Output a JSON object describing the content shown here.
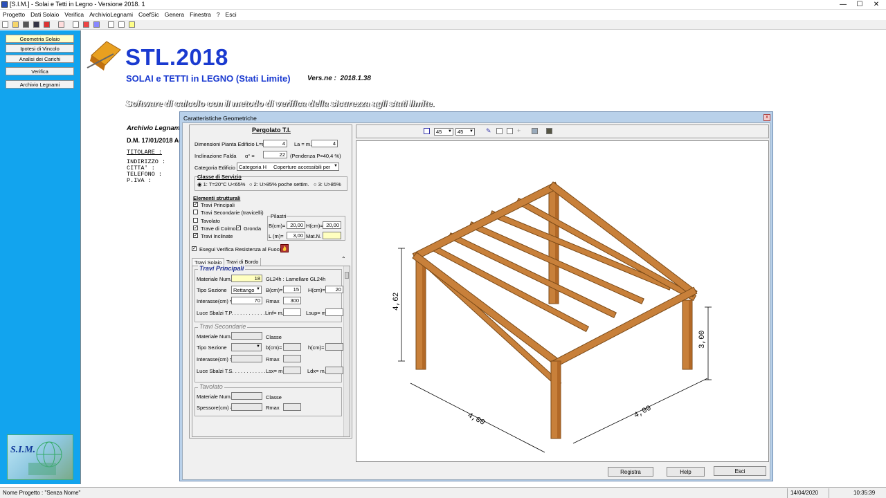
{
  "window": {
    "title": "[S.I.M.] - Solai e Tetti in Legno - Versione  2018. 1",
    "minimize": "—",
    "maximize": "☐",
    "close": "✕"
  },
  "menu": [
    "Progetto",
    "Dati Solaio",
    "Verifica",
    "ArchivioLegnami",
    "CoefSic",
    "Genera",
    "Finestra",
    "?",
    "Esci"
  ],
  "sidebar": {
    "items": [
      {
        "label": "Geometria Solaio"
      },
      {
        "label": "Ipotesi di Vincolo"
      },
      {
        "label": "Analisi dei Carichi"
      },
      {
        "label": "Verifica"
      },
      {
        "label": "Archivio Legnami"
      }
    ],
    "logo_text": "S.I.M."
  },
  "splash": {
    "title": "STL.2018",
    "subtitle": "SOLAI e TETTI in LEGNO (Stati Limite)",
    "version_label": "Vers.ne :",
    "version": "2018.1.38",
    "tagline": "Software di calcolo con il metodo di verifica della sicurezza agli stati limite.",
    "archivio": "Archivio Legnami,",
    "dm": "D.M. 17/01/2018  Ac",
    "titolare": "TITOLARE  :",
    "indirizzo": "INDIRIZZO :",
    "citta": "CITTA'    :",
    "telefono": "TELEFONO  :",
    "piva": "P.IVA     :"
  },
  "dialog": {
    "title": "Caratteristiche Geometriche",
    "close": "x",
    "panel_title": "Pergolato T.I.",
    "dim_label": "Dimensioni Pianta Edificio L=m.",
    "L": "4",
    "La_label": "La = m.",
    "La": "4",
    "incl_label": "Inclinazione Falda",
    "alpha_label": "α°  =",
    "alpha": "22",
    "pendenza": "(Pendenza P=40,4 %)",
    "cat_label": "Categoria Edificio",
    "cat_value": "Categoria H",
    "cat_desc": "Coperture accessibili per s",
    "classe_title": "Classe di Servizio",
    "classe": [
      "1: T=20°C  U<65%",
      "2: U>85% poche settim.",
      "3: U>85%"
    ],
    "elementi_title": "Elementi strutturali",
    "elementi": [
      {
        "label": "Travi Principali",
        "checked": true
      },
      {
        "label": "Travi Secondarie (travicelli)",
        "checked": false
      },
      {
        "label": "Tavolato",
        "checked": false
      },
      {
        "label": "Trave di Colmo",
        "checked": true
      },
      {
        "label": "Travi Inclinate",
        "checked": true
      }
    ],
    "gronda_label": "Gronda",
    "pilastri_title": "Pilastri",
    "B_label": "B(cm)=",
    "B": "20,00",
    "H_label": "H(cm)=",
    "H": "20,00",
    "Lp_label": "L (m)=",
    "Lp": "3,00",
    "mat_label": "Mat.N.",
    "fuoco_label": "Esegui Verifica Resistenza al Fuoco",
    "tabs": [
      "Travi Solaio",
      "Travi di Bordo"
    ],
    "tp_title": "Travi Principali",
    "mat_num_label": "Materiale Num.",
    "mat_num": "18",
    "mat_desc": "GL24h : Lamellare GL24h",
    "tipo_label": "Tipo Sezione",
    "tipo": "Rettango",
    "bcm_label": "B(cm)=",
    "bcm": "15",
    "hcm_label": "H(cm)=",
    "hcm": "20",
    "inter_label": "Interasse(cm) =",
    "inter": "70",
    "rmax_label": "Rmax",
    "rmax": "300",
    "luce_label": "Luce Sbalzi T.P. . . . . . . . . . . .",
    "linf_label": "Linf= m.",
    "lsup_label": "Lsup= m.",
    "ts_title": "Travi Secondarie",
    "classe_label": "Classe",
    "bsm_label": "b(cm)=",
    "hsm_label": "h(cm)=",
    "luce_ts_label": "Luce Sbalzi T.S. . . . . . . . . . . .",
    "lsx_label": "Lsx= m.",
    "ldx_label": "Ldx= m.",
    "tav_title": "Tavolato",
    "spess_label": "Spessore(cm) =",
    "view_angle1": "45",
    "view_angle2": "45",
    "dim_h": "4,62",
    "dim_p": "3,00",
    "dim_l": "4,00",
    "dim_w": "4,00",
    "buttons": [
      "Registra",
      "Help",
      "Esci"
    ]
  },
  "status": {
    "project": "Nome Progetto : \"Senza Nome\"",
    "date": "14/04/2020",
    "time": "10:35:39"
  },
  "colors": {
    "sidebar": "#12a4ee",
    "brand": "#1a3ad0",
    "wood": "#c8803a",
    "dialog_frame": "#b9d1ea"
  }
}
